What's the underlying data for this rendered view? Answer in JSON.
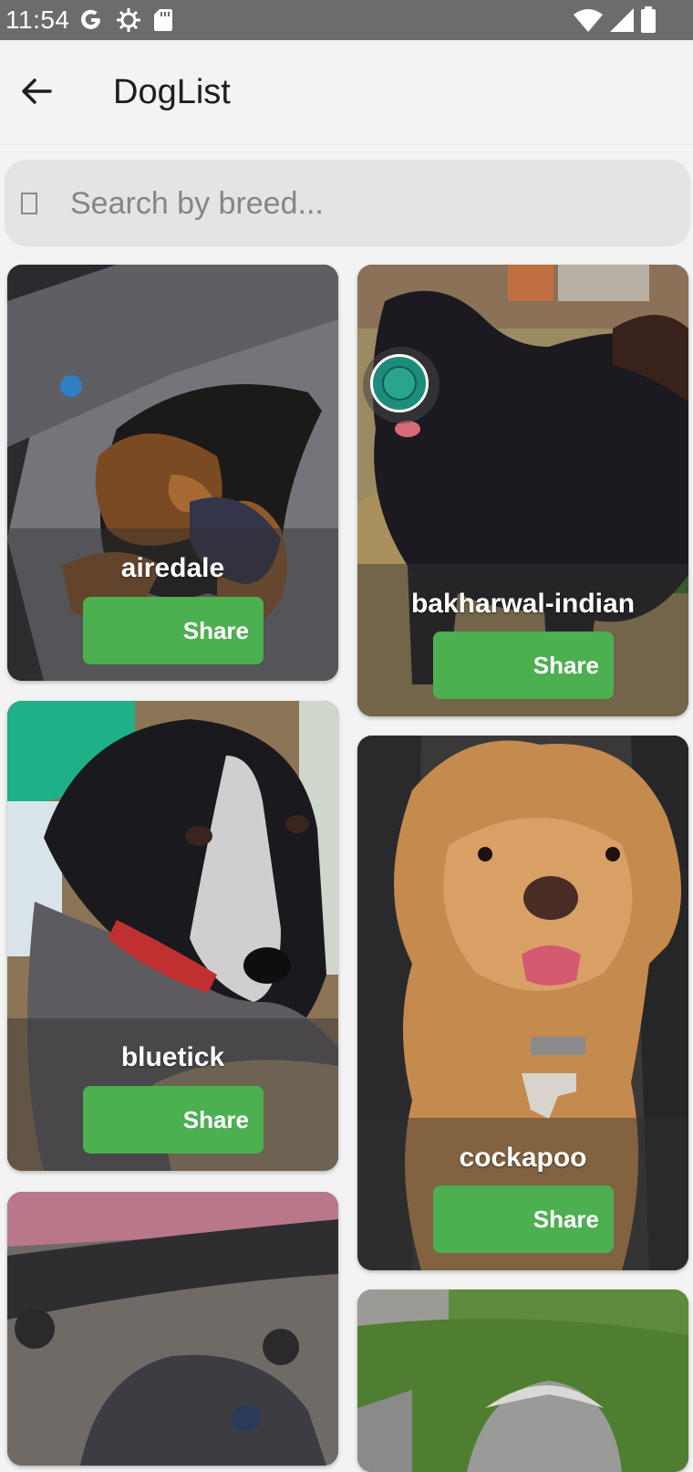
{
  "status_bar": {
    "time": "11:54",
    "left_icons": [
      "google-g-icon",
      "settings-gear-icon",
      "sd-card-icon"
    ],
    "right_icons": [
      "wifi-icon",
      "cell-signal-icon",
      "battery-icon"
    ]
  },
  "app_bar": {
    "back_icon": "arrow-back-icon",
    "title": "DogList"
  },
  "search": {
    "placeholder": "Search by breed...",
    "value": "",
    "icon": "missing-glyph-icon"
  },
  "dogs": [
    {
      "breed": "airedale",
      "share_label": "Share",
      "photo": "dog-photo-icon"
    },
    {
      "breed": "bakharwal-indian",
      "share_label": "Share",
      "photo": "dog-photo-icon"
    },
    {
      "breed": "bluetick",
      "share_label": "Share",
      "photo": "dog-photo-icon"
    },
    {
      "breed": "cockapoo",
      "share_label": "Share",
      "photo": "dog-photo-icon"
    },
    {
      "breed": "",
      "share_label": "",
      "photo": "dog-photo-icon"
    },
    {
      "breed": "",
      "share_label": "",
      "photo": "dog-photo-icon"
    }
  ],
  "colors": {
    "status_bar": "#6c6c6c",
    "background": "#f3f3f3",
    "search_field": "#e4e4e4",
    "share_button": "#4caf50",
    "touch_indicator": "#1e8c7a"
  }
}
